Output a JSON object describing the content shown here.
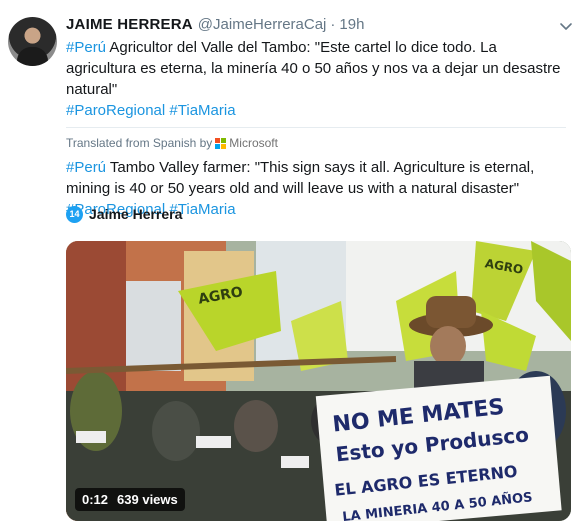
{
  "tweet": {
    "author_name": "JAIME HERRERA",
    "handle": "@JaimeHerreraCaj",
    "separator": "·",
    "time": "19h",
    "original": {
      "hashtag_peru": "#Perú",
      "body": " Agricultor del Valle del Tambo: \"Este cartel lo dice todo. La agricultura es eterna, la minería 40 o 50 años y nos va a dejar un desastre natural\"",
      "hashtag_paro": "#ParoRegional",
      "hashtag_tia": "#TiaMaria"
    },
    "translation": {
      "label": "Translated from Spanish by",
      "provider": "Microsoft",
      "hashtag_peru": "#Perú",
      "body": " Tambo Valley farmer: \"This sign says it all. Agriculture is eternal, mining is 40 or 50 years old and will leave us with a natural disaster\"",
      "hashtag_paro": "#ParoRegional",
      "hashtag_tia": "#TiaMaria"
    }
  },
  "media": {
    "author": "Jaime Herrera",
    "logo_text": "14",
    "duration": "0:12",
    "views": "639 views",
    "sign_text": [
      "NO ME MATES",
      "Esto yo Produsco",
      "EL AGRO ES ETERNO",
      "LA MINERIA 40 A 50 AÑOS"
    ],
    "flag_text": "AGRO",
    "flag_text_2": "AGRO"
  },
  "colors": {
    "link": "#1b95e0",
    "text": "#14171a",
    "muted": "#657786",
    "flag_green": "#b9d52a",
    "ms_red": "#f25022",
    "ms_green": "#7fba00",
    "ms_blue": "#00a4ef",
    "ms_yellow": "#ffb900"
  }
}
